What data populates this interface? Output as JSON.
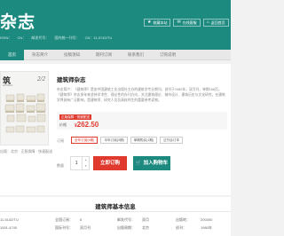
{
  "header": {
    "title": "杂志",
    "meta": [
      "ISSN：",
      "CN：",
      "邮发代号：",
      "国内统一刊号：",
      "CN：11-5742/TU"
    ],
    "favorite": "收藏本站",
    "contact": "在线客服",
    "home": "返回首页"
  },
  "nav": {
    "items": [
      "首页",
      "杂志简介",
      "投稿须知",
      "期刊订阅",
      "联系我们",
      "订购说明"
    ]
  },
  "cover": {
    "letters": "筑",
    "issue": "2/2",
    "sub": "architect",
    "caption": "出版：北京 · 正版保障 · 快速配送"
  },
  "product": {
    "title": "建筑师杂志",
    "description": "杂志简介：《建筑师》是由中国建筑工业出版社主办的建筑学专业期刊，创刊于1980年，双月刊，单期168页。《建筑师》杂志多年来坚持学术性、理论性的办刊方向，关注建筑理论、城市设计、建筑历史与文化研究，在建筑学界具有广泛影响，是建筑师、研究人员及高校师生的重要参考读物。",
    "badge": "正版保障 · 快速配送",
    "price_label": "价格",
    "currency": "¥",
    "price": "262.50"
  },
  "options": {
    "label": "订阅",
    "items": [
      "全年订阅(6期)",
      "半年订阅(3期)",
      "单期购买(1期)",
      "过刊合订本"
    ],
    "selected_index": 0
  },
  "purchase": {
    "qty_label": "数量",
    "quantity": "1",
    "buy_label": "立即订购",
    "cart_label": "加入购物车",
    "up_glyph": "▲",
    "down_glyph": "▼"
  },
  "info": {
    "title": "建筑师基本信息",
    "row1": {
      "a": "11-5142/TU",
      "b_label": "全国订阅：",
      "b": "6",
      "c_label": "邮发代号：",
      "c": "双月",
      "d_label": "出版地：",
      "d": "200300"
    },
    "row2": {
      "a": "1001-4740",
      "b_label": "国际刊号：",
      "b": "双月刊",
      "c_label": "出版周期：",
      "c": "北京",
      "d_label": "创刊：",
      "d": "1980年"
    }
  },
  "colors": {
    "brand": "#1d8a80",
    "accent": "#e03a2f"
  }
}
